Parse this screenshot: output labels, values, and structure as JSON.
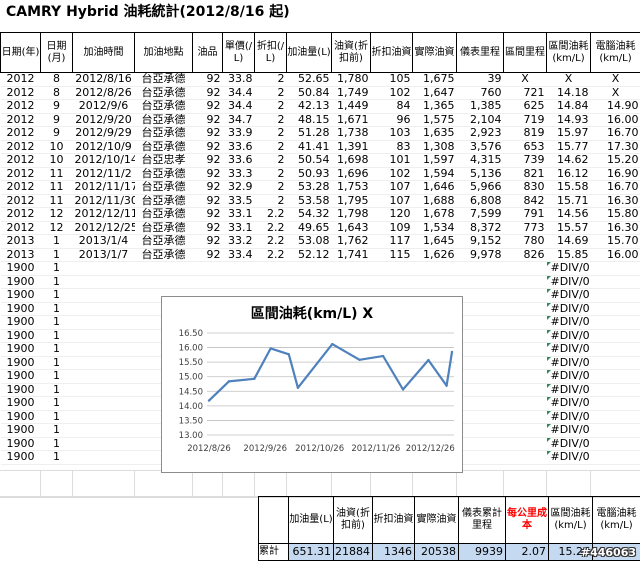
{
  "title": "CAMRY Hybrid 油耗統計(2012/8/16 起)",
  "headers": [
    "日期(年)",
    "日期(月)",
    "加油時間",
    "加油地點",
    "油品",
    "單價(/L)",
    "折扣(/L)",
    "加油量(L)",
    "油資(折扣前)",
    "折扣油資",
    "實際油資",
    "儀表里程",
    "區間里程",
    "區間油耗(km/L)",
    "電腦油耗(km/L)"
  ],
  "rows": [
    [
      "2012",
      "8",
      "2012/8/16",
      "台亞承德",
      "92",
      "33.8",
      "2",
      "52.65",
      "1,780",
      "105",
      "1,675",
      "39",
      "X",
      "X",
      "X"
    ],
    [
      "2012",
      "8",
      "2012/8/26",
      "台亞承德",
      "92",
      "34.4",
      "2",
      "50.84",
      "1,749",
      "102",
      "1,647",
      "760",
      "721",
      "14.18",
      "X"
    ],
    [
      "2012",
      "9",
      "2012/9/6",
      "台亞承德",
      "92",
      "34.4",
      "2",
      "42.13",
      "1,449",
      "84",
      "1,365",
      "1,385",
      "625",
      "14.84",
      "14.90"
    ],
    [
      "2012",
      "9",
      "2012/9/20",
      "台亞承德",
      "92",
      "34.7",
      "2",
      "48.15",
      "1,671",
      "96",
      "1,575",
      "2,104",
      "719",
      "14.93",
      "16.00"
    ],
    [
      "2012",
      "9",
      "2012/9/29",
      "台亞承德",
      "92",
      "33.9",
      "2",
      "51.28",
      "1,738",
      "103",
      "1,635",
      "2,923",
      "819",
      "15.97",
      "16.70"
    ],
    [
      "2012",
      "10",
      "2012/10/9",
      "台亞承德",
      "92",
      "33.6",
      "2",
      "41.41",
      "1,391",
      "83",
      "1,308",
      "3,576",
      "653",
      "15.77",
      "17.30"
    ],
    [
      "2012",
      "10",
      "2012/10/14",
      "台亞忠孝",
      "92",
      "33.6",
      "2",
      "50.54",
      "1,698",
      "101",
      "1,597",
      "4,315",
      "739",
      "14.62",
      "15.20"
    ],
    [
      "2012",
      "11",
      "2012/11/2",
      "台亞承德",
      "92",
      "33.3",
      "2",
      "50.93",
      "1,696",
      "102",
      "1,594",
      "5,136",
      "821",
      "16.12",
      "16.90"
    ],
    [
      "2012",
      "11",
      "2012/11/17",
      "台亞承德",
      "92",
      "32.9",
      "2",
      "53.28",
      "1,753",
      "107",
      "1,646",
      "5,966",
      "830",
      "15.58",
      "16.70"
    ],
    [
      "2012",
      "11",
      "2012/11/30",
      "台亞承德",
      "92",
      "33.5",
      "2",
      "53.58",
      "1,795",
      "107",
      "1,688",
      "6,808",
      "842",
      "15.71",
      "16.30"
    ],
    [
      "2012",
      "12",
      "2012/12/11",
      "台亞承德",
      "92",
      "33.1",
      "2.2",
      "54.32",
      "1,798",
      "120",
      "1,678",
      "7,599",
      "791",
      "14.56",
      "15.80"
    ],
    [
      "2012",
      "12",
      "2012/12/25",
      "台亞承德",
      "92",
      "33.1",
      "2.2",
      "49.65",
      "1,643",
      "109",
      "1,534",
      "8,372",
      "773",
      "15.57",
      "16.30"
    ],
    [
      "2013",
      "1",
      "2013/1/4",
      "台亞承德",
      "92",
      "33.2",
      "2.2",
      "53.08",
      "1,762",
      "117",
      "1,645",
      "9,152",
      "780",
      "14.69",
      "15.70"
    ],
    [
      "2013",
      "1",
      "2013/1/7",
      "台亞承德",
      "92",
      "33.4",
      "2.2",
      "52.12",
      "1,741",
      "115",
      "1,626",
      "9,978",
      "826",
      "15.85",
      "16.00"
    ]
  ],
  "placeholder_row": {
    "year": "1900",
    "month": "1",
    "error": "#DIV/0!",
    "count": 15
  },
  "summary": {
    "headers": [
      "加油量(L)",
      "油資(折扣前)",
      "折扣油資",
      "實際油資",
      "儀表累計里程",
      "每公里成本",
      "區間油耗(km/L)",
      "電腦油耗(km/L)"
    ],
    "highlight_header_index": 5,
    "label": "累計",
    "values": [
      "651.31",
      "21884",
      "1346",
      "20538",
      "9939",
      "2.07",
      "15.26",
      ""
    ]
  },
  "watermark": "#446063",
  "chart_data": {
    "type": "line",
    "title": "區間油耗(km/L) X",
    "x": [
      "2012/8/26",
      "2012/9/6",
      "2012/9/20",
      "2012/9/29",
      "2012/10/9",
      "2012/10/14",
      "2012/11/2",
      "2012/11/17",
      "2012/11/30",
      "2012/12/11",
      "2012/12/25",
      "2013/1/4",
      "2013/1/7"
    ],
    "xticks": [
      "2012/8/26",
      "2012/9/26",
      "2012/10/26",
      "2012/11/26",
      "2012/12/26"
    ],
    "series": [
      {
        "values": [
          14.18,
          14.84,
          14.93,
          15.97,
          15.77,
          14.62,
          16.12,
          15.58,
          15.71,
          14.56,
          15.57,
          14.69,
          15.85
        ]
      }
    ],
    "ylim": [
      13.0,
      16.5
    ],
    "yticks": [
      "13.00",
      "13.50",
      "14.00",
      "14.50",
      "15.00",
      "15.50",
      "16.00",
      "16.50"
    ],
    "grid": true,
    "line_color": "#4f81bd"
  }
}
